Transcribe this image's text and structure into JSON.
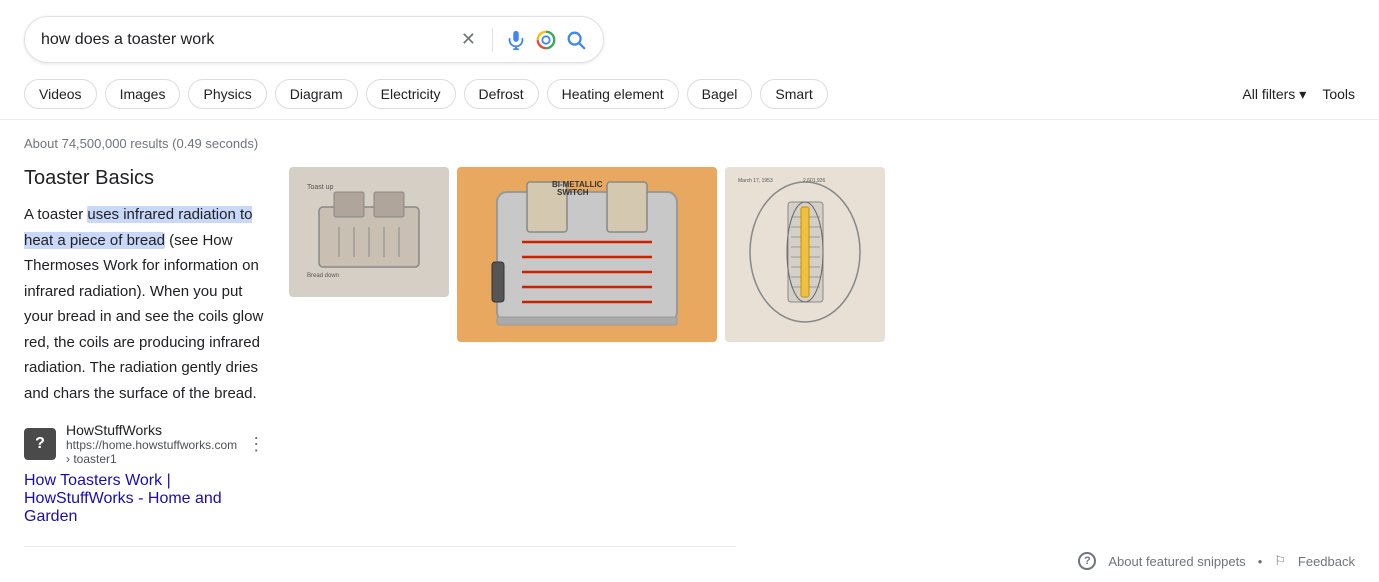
{
  "search": {
    "query": "how does a toaster work",
    "placeholder": "Search"
  },
  "chips": {
    "items": [
      {
        "label": "Videos",
        "id": "videos"
      },
      {
        "label": "Images",
        "id": "images"
      },
      {
        "label": "Physics",
        "id": "physics"
      },
      {
        "label": "Diagram",
        "id": "diagram"
      },
      {
        "label": "Electricity",
        "id": "electricity"
      },
      {
        "label": "Defrost",
        "id": "defrost"
      },
      {
        "label": "Heating element",
        "id": "heating-element"
      },
      {
        "label": "Bagel",
        "id": "bagel"
      },
      {
        "label": "Smart",
        "id": "smart"
      }
    ],
    "all_filters": "All filters",
    "tools": "Tools"
  },
  "results": {
    "count": "About 74,500,000 results (0.49 seconds)",
    "snippet": {
      "title": "Toaster Basics",
      "text_before_highlight": "A toaster ",
      "highlight": "uses infrared radiation to heat a piece of bread",
      "text_after_highlight": " (see How Thermoses Work for information on infrared radiation). When you put your bread in and see the coils glow red, the coils are producing infrared radiation. The radiation gently dries and chars the surface of the bread.",
      "source_name": "HowStuffWorks",
      "source_url": "https://home.howstuffworks.com › toaster1",
      "favicon_letter": "?",
      "link_text": "How Toasters Work | HowStuffWorks - Home and Garden",
      "link_href": "#"
    }
  },
  "footer": {
    "about_snippets": "About featured snippets",
    "feedback": "Feedback",
    "dot": "•"
  },
  "images": {
    "placeholder_colors": [
      "#d6cfc5",
      "#e8a860",
      "#e8e0d4"
    ],
    "descriptions": [
      "toaster diagram left",
      "toaster cross-section center",
      "toaster patent right"
    ]
  },
  "icons": {
    "clear": "✕",
    "mic_label": "search-by-voice",
    "camera_label": "search-by-image",
    "search_label": "google-search",
    "chevron_down": "▾",
    "question_mark": "?",
    "feedback_icon": "⚐",
    "dots_menu": "⋮"
  }
}
